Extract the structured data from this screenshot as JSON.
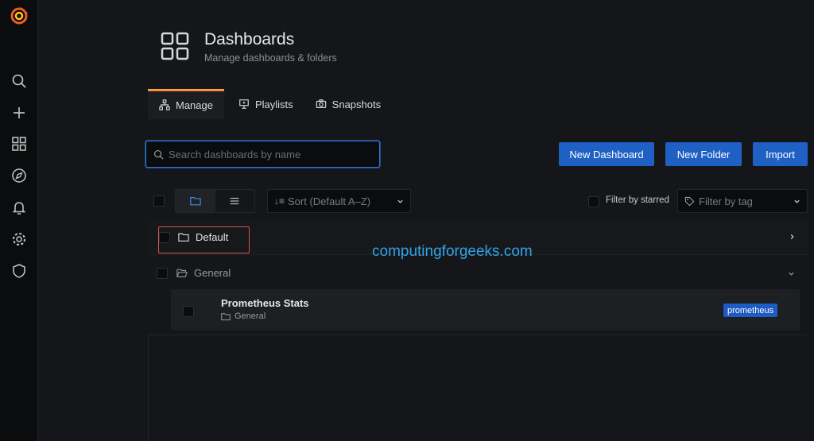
{
  "sidebar": {
    "items": [
      {
        "name": "grafana-logo-icon"
      },
      {
        "name": "search-icon"
      },
      {
        "name": "plus-icon"
      },
      {
        "name": "dashboards-icon"
      },
      {
        "name": "explore-compass-icon"
      },
      {
        "name": "alerting-bell-icon"
      },
      {
        "name": "configuration-gear-icon"
      },
      {
        "name": "server-admin-shield-icon"
      }
    ]
  },
  "header": {
    "title": "Dashboards",
    "subtitle": "Manage dashboards & folders"
  },
  "tabs": [
    {
      "label": "Manage",
      "active": true
    },
    {
      "label": "Playlists",
      "active": false
    },
    {
      "label": "Snapshots",
      "active": false
    }
  ],
  "toolbar": {
    "search_placeholder": "Search dashboards by name",
    "new_dashboard_label": "New Dashboard",
    "new_folder_label": "New Folder",
    "import_label": "Import"
  },
  "filters": {
    "sort_value": "Sort (Default A–Z)",
    "starred_label": "Filter by starred",
    "tag_placeholder": "Filter by tag"
  },
  "folders": [
    {
      "name": "Default",
      "expanded": false
    },
    {
      "name": "General",
      "expanded": true
    }
  ],
  "dashboards": [
    {
      "title": "Prometheus Stats",
      "folder": "General",
      "tag": "prometheus"
    }
  ],
  "watermark": "computingforgeeks.com",
  "colors": {
    "primary_button": "#1f60c4",
    "tab_active_accent": "#f5a742",
    "search_focus": "#3274d9",
    "highlight_box": "#d9534f",
    "watermark": "#2fa4e7"
  }
}
